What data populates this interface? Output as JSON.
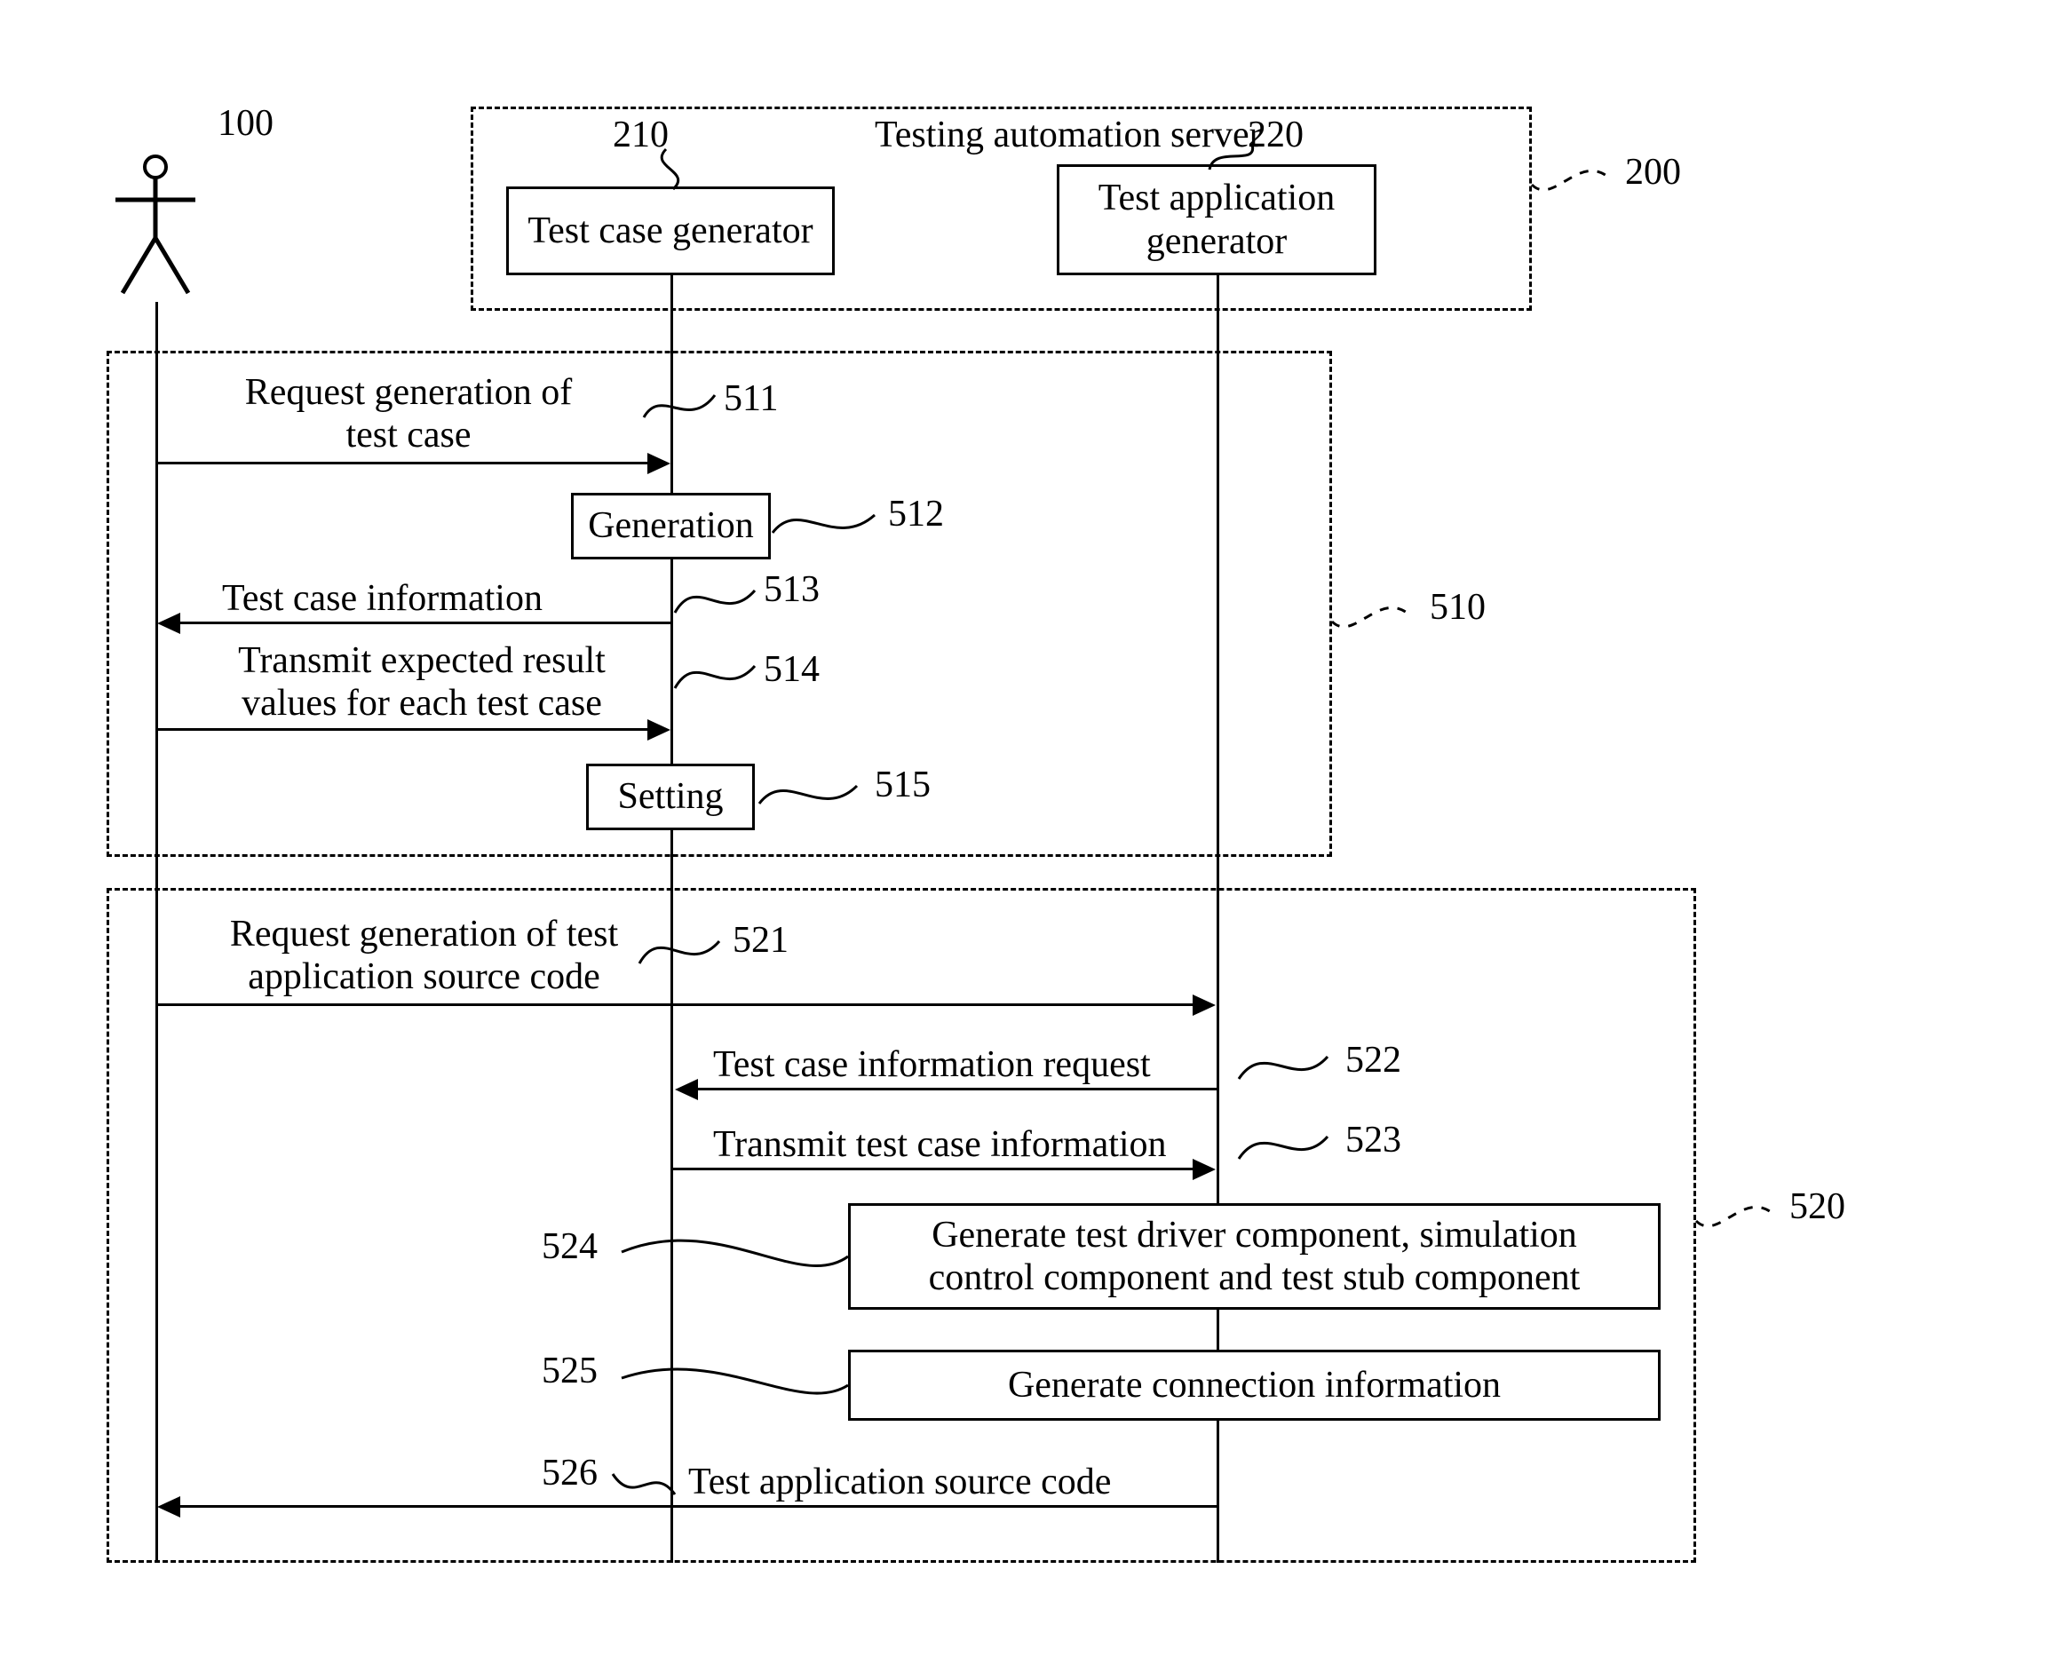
{
  "actors": {
    "user": {
      "ref": "100"
    },
    "server_frame": {
      "title": "Testing automation server",
      "ref": "200"
    },
    "test_case_generator": {
      "label": "Test case generator",
      "ref": "210"
    },
    "test_app_generator": {
      "label": "Test application\ngenerator",
      "ref": "220"
    },
    "test_app_generator_line1": "Test application",
    "test_app_generator_line2": "generator"
  },
  "phase1": {
    "frame_ref": "510",
    "msg511": {
      "text_l1": "Request generation of",
      "text_l2": "test case",
      "ref": "511"
    },
    "act512": {
      "label": "Generation",
      "ref": "512"
    },
    "msg513": {
      "text": "Test case information",
      "ref": "513"
    },
    "msg514": {
      "text_l1": "Transmit expected result",
      "text_l2": "values for each test case",
      "ref": "514"
    },
    "act515": {
      "label": "Setting",
      "ref": "515"
    }
  },
  "phase2": {
    "frame_ref": "520",
    "msg521": {
      "text_l1": "Request generation of test",
      "text_l2": "application source code",
      "ref": "521"
    },
    "msg522": {
      "text": "Test case information request",
      "ref": "522"
    },
    "msg523": {
      "text": "Transmit test case information",
      "ref": "523"
    },
    "act524": {
      "text_l1": "Generate test driver component, simulation",
      "text_l2": "control component and test stub component",
      "ref": "524"
    },
    "act525": {
      "text": "Generate connection information",
      "ref": "525"
    },
    "msg526": {
      "text": "Test application source code",
      "ref": "526"
    }
  }
}
